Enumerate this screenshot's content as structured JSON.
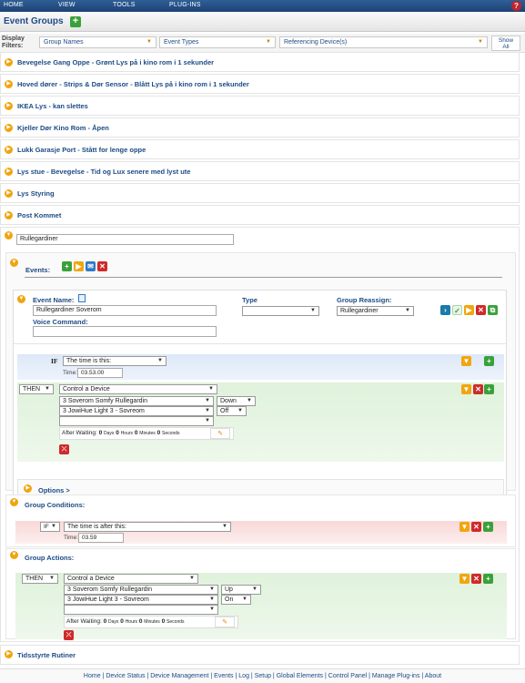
{
  "menu": {
    "home": "HOME",
    "view": "VIEW",
    "tools": "TOOLS",
    "plugins": "PLUG-INS"
  },
  "title": "Event Groups",
  "filters": {
    "label_line1": "Display",
    "label_line2": "Filters:",
    "group_names": "Group Names",
    "event_types": "Event Types",
    "referencing_devices": "Referencing Device(s)",
    "show_all_line1": "Show",
    "show_all_line2": "All"
  },
  "groups": [
    "Bevegelse Gang Oppe - Grønt Lys på i kino rom i 1 sekunder",
    "Hoved dører - Strips & Dør Sensor - Blått Lys på i kino rom i 1 sekunder",
    "IKEA Lys - kan slettes",
    "Kjeller Dør Kino Rom - Åpen",
    "Lukk Garasje Port - Stått for lenge oppe",
    "Lys stue - Bevegelse - Tid og Lux senere med lyst ute",
    "Lys Styring",
    "Post Kommet"
  ],
  "expanded_group": {
    "name": "Rullegardiner",
    "events_label": "Events:",
    "event": {
      "name_label": "Event Name:",
      "name_value": "Rullegardiner Soverom",
      "voice_label": "Voice Command:",
      "voice_value": "",
      "type_label": "Type",
      "type_value": "",
      "reassign_label": "Group Reassign:",
      "reassign_value": "Rullegardiner",
      "if_label": "IF",
      "if_value": "The time is this:",
      "time_label": "Time:",
      "time_value": "03.53.00",
      "then_label": "THEN",
      "then_value": "Control a Device",
      "dev1": "3 Soverom Somfy Rullegardin",
      "dev1_action": "Down",
      "dev2": "3 JowiHue Light 3 - Sovreom",
      "dev2_action": "Off",
      "after_label": "After Waiting:",
      "days_num": "0",
      "days": "Days",
      "hours_num": "0",
      "hours": "Hours",
      "minutes_num": "0",
      "minutes": "Minutes",
      "seconds_num": "0",
      "seconds": "Seconds",
      "options": "Options >"
    },
    "conditions": {
      "label": "Group Conditions:",
      "if_label": "IF",
      "if_value": "The time is after this:",
      "time_label": "Time:",
      "time_value": "03.59"
    },
    "actions": {
      "label": "Group Actions:",
      "then_label": "THEN",
      "then_value": "Control a Device",
      "dev1": "3 Soverom Somfy Rullegardin",
      "dev1_action": "Up",
      "dev2": "3 JowiHue Light 3 - Sovreom",
      "dev2_action": "On",
      "after_label": "After Waiting:",
      "days_num": "0",
      "days": "Days",
      "hours_num": "0",
      "hours": "Hours",
      "minutes_num": "0",
      "minutes": "Minutes",
      "seconds_num": "0",
      "seconds": "Seconds"
    }
  },
  "last_group": "Tidsstyrte Rutiner",
  "footer": [
    "Home",
    "Device Status",
    "Device Management",
    "Events",
    "Log",
    "Setup",
    "Global Elements",
    "Control Panel",
    "Manage Plug-ins",
    "About"
  ]
}
